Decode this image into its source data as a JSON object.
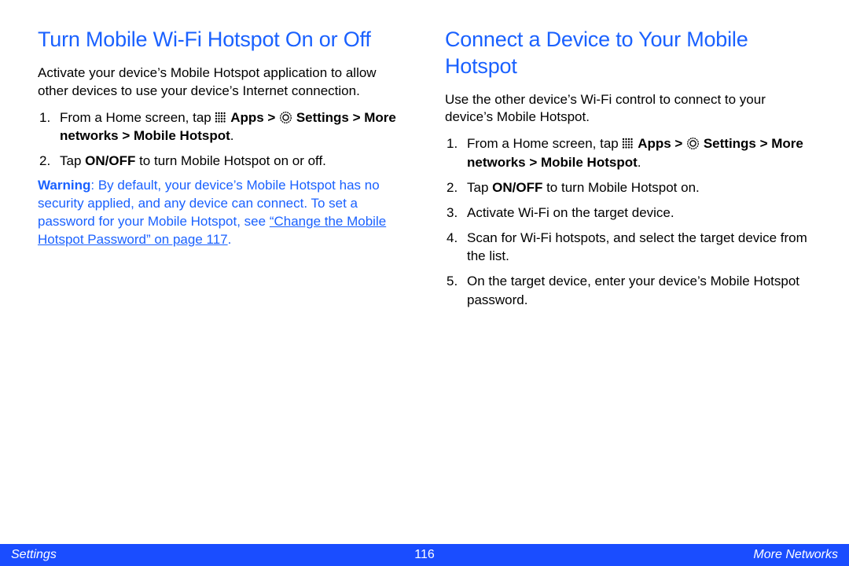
{
  "left": {
    "heading": "Turn Mobile Wi-Fi Hotspot On or Off",
    "intro": "Activate your device’s Mobile Hotspot application to allow other devices to use your device’s Internet connection.",
    "step1_pre": "From a Home screen, tap ",
    "step1_apps": "Apps >",
    "step1_settings": "Settings > More networks > Mobile Hotspot",
    "step1_end": ".",
    "step2_pre": "Tap ",
    "step2_bold": "ON/OFF",
    "step2_post": " to turn Mobile Hotspot on or off.",
    "warn_label": "Warning",
    "warn_body": ": By default, your device’s Mobile Hotspot has no security applied, and any device can connect. To set a password for your Mobile Hotspot, see ",
    "warn_link": "“Change the Mobile Hotspot Password” on page 117",
    "warn_end": "."
  },
  "right": {
    "heading": "Connect a Device to Your Mobile Hotspot",
    "intro": "Use the other device’s Wi-Fi control to connect to your device’s Mobile Hotspot.",
    "step1_pre": "From a Home screen, tap ",
    "step1_apps": "Apps >",
    "step1_settings": "Settings > More networks > Mobile Hotspot",
    "step1_end": ".",
    "step2_pre": "Tap ",
    "step2_bold": "ON/OFF",
    "step2_post": " to turn Mobile Hotspot on.",
    "step3": "Activate Wi-Fi on the target device.",
    "step4": "Scan for Wi-Fi hotspots, and select the target device from the list.",
    "step5": "On the target device, enter your device’s Mobile Hotspot password."
  },
  "footer": {
    "left": "Settings",
    "center": "116",
    "right": "More Networks"
  },
  "icons": {
    "apps": "apps-grid-icon",
    "settings": "settings-gear-icon"
  }
}
